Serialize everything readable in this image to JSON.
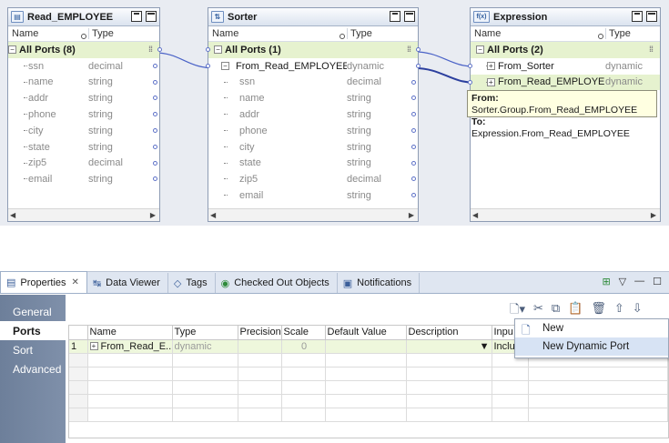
{
  "canvas": {
    "read_employee": {
      "title": "Read_EMPLOYEE",
      "col_name": "Name",
      "col_type": "Type",
      "group_label": "All Ports (8)",
      "ports": [
        {
          "name": "ssn",
          "type": "decimal"
        },
        {
          "name": "name",
          "type": "string"
        },
        {
          "name": "addr",
          "type": "string"
        },
        {
          "name": "phone",
          "type": "string"
        },
        {
          "name": "city",
          "type": "string"
        },
        {
          "name": "state",
          "type": "string"
        },
        {
          "name": "zip5",
          "type": "decimal"
        },
        {
          "name": "email",
          "type": "string"
        }
      ]
    },
    "sorter": {
      "title": "Sorter",
      "col_name": "Name",
      "col_type": "Type",
      "group_label": "All Ports (1)",
      "dynamic_port": {
        "name": "From_Read_EMPLOYEE",
        "type": "dynamic"
      },
      "ports": [
        {
          "name": "ssn",
          "type": "decimal"
        },
        {
          "name": "name",
          "type": "string"
        },
        {
          "name": "addr",
          "type": "string"
        },
        {
          "name": "phone",
          "type": "string"
        },
        {
          "name": "city",
          "type": "string"
        },
        {
          "name": "state",
          "type": "string"
        },
        {
          "name": "zip5",
          "type": "decimal"
        },
        {
          "name": "email",
          "type": "string"
        }
      ]
    },
    "expression": {
      "title": "Expression",
      "icon_text": "f(x)",
      "col_name": "Name",
      "col_type": "Type",
      "group_label": "All Ports (2)",
      "ports": [
        {
          "name": "From_Sorter",
          "type": "dynamic"
        },
        {
          "name": "From_Read_EMPLOYEE",
          "type": "dynamic"
        }
      ]
    },
    "tooltip": {
      "from_label": "From:",
      "from_value": "Sorter.Group.From_Read_EMPLOYEE",
      "to_label": "To:",
      "to_value": "Expression.From_Read_EMPLOYEE"
    }
  },
  "properties": {
    "tabs": [
      {
        "label": "Properties",
        "icon": "properties-icon",
        "active": true
      },
      {
        "label": "Data Viewer",
        "icon": "data-viewer-icon"
      },
      {
        "label": "Tags",
        "icon": "tag-icon"
      },
      {
        "label": "Checked Out Objects",
        "icon": "checked-out-icon"
      },
      {
        "label": "Notifications",
        "icon": "notifications-icon"
      }
    ],
    "sidebar": [
      "General",
      "Ports",
      "Sort",
      "Advanced"
    ],
    "grid": {
      "headers": [
        "Name",
        "Type",
        "Precision",
        "Scale",
        "Default Value",
        "Description",
        "Inpu"
      ],
      "rows": [
        {
          "num": "1",
          "name": "From_Read_E...",
          "type": "dynamic",
          "precision": "",
          "scale": "0",
          "default": "",
          "description": "",
          "input": "Inclu"
        }
      ]
    },
    "menu": {
      "items": [
        "New",
        "New Dynamic Port"
      ]
    }
  }
}
